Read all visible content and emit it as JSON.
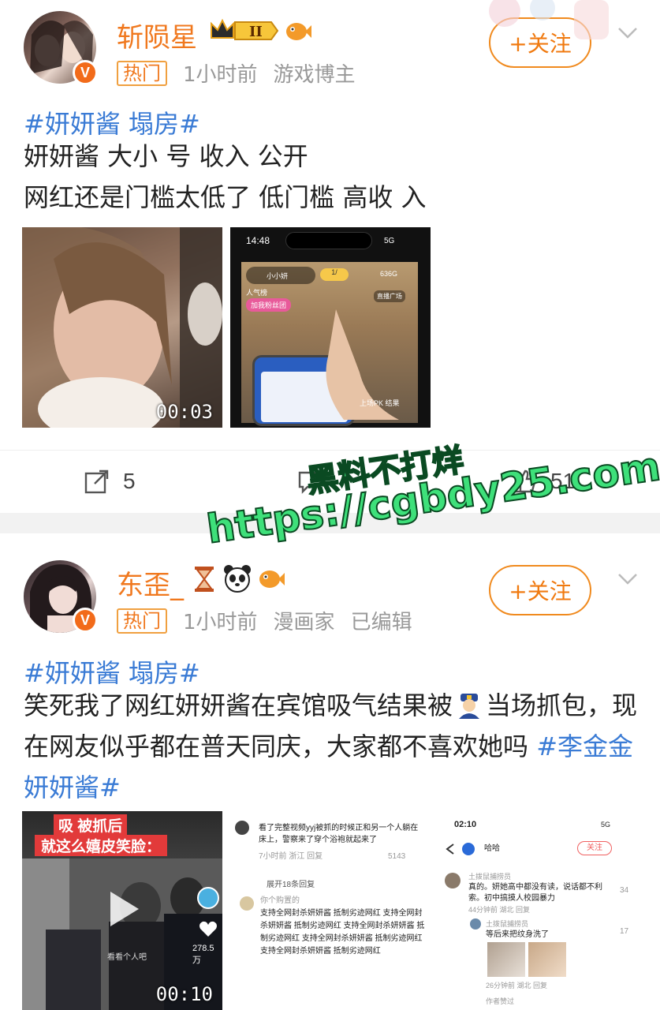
{
  "posts": [
    {
      "username": "斩陨星",
      "level_badge": "II",
      "hot_tag": "热门",
      "time": "1小时前",
      "role": "游戏博主",
      "follow_label": "+关注",
      "topic": "#妍妍酱 塌房#",
      "lines": [
        "妍妍酱 大小 号 收入 公开",
        "网红还是门槛太低了 低门槛 高收 入"
      ],
      "media": [
        {
          "duration": "00:03"
        },
        {
          "status_time": "14:48",
          "status_net": "5G",
          "live_name": "小小妍",
          "live_badge": "1/",
          "live_count": "636G",
          "live_tag": "人气榜",
          "live_btn": "加我粉丝团",
          "plaza": "直播广场",
          "pk": "上场PK 结果"
        }
      ],
      "actions": {
        "repost": "5",
        "comment": "",
        "like": "51"
      }
    },
    {
      "username": "东歪_",
      "hot_tag": "热门",
      "time": "1小时前",
      "role": "漫画家",
      "edited": "已编辑",
      "follow_label": "+关注",
      "topic": "#妍妍酱 塌房#",
      "body_pre": "笑死我了网红妍妍酱在宾馆吸气结果被",
      "body_post": "当场抓包，现在网友似乎都在普天同庆，大家都不喜欢她吗",
      "body_link": "#李金金 妍妍酱#",
      "media": [
        {
          "caption1": "吸 被抓后",
          "caption2": "就这么嬉皮笑脸：",
          "duration": "00:10",
          "likes": "278.5万",
          "bottom_text": "看看个人吧"
        },
        {
          "comment_text": "看了完整视频yyj被抓的时候正和另一个人躺在床上，警察来了穿个浴袍就起来了",
          "meta": "7小时前  浙江  回复",
          "likes": "5143",
          "expand": "展开18条回复",
          "user2": "你个购置的",
          "spam": "支持全网封杀妍妍酱 抵制劣迹网红 支持全网封杀妍妍酱 抵制劣迹网红 支持全网封杀妍妍酱 抵制劣迹网红 支持全网封杀妍妍酱 抵制劣迹网红 支持全网封杀妍妍酱 抵制劣迹网红"
        },
        {
          "time": "02:10",
          "net": "5G",
          "title": "哈哈",
          "follow": "关注",
          "c1_name": "土拨鼠捕捞员",
          "c1_text": "真的。妍她高中都没有读，说话都不利索。初中搞摸人校园暴力",
          "c1_meta": "44分钟前 湖北 回复",
          "c1_likes": "34",
          "c2_name": "土拨鼠捕捞员",
          "c2_text": "等后来把纹身洗了",
          "c2_likes": "17",
          "c2_meta": "26分钟前 湖北 回复",
          "footer": "作者赞过"
        }
      ]
    }
  ],
  "watermark": {
    "line1": "黑料不打烊",
    "line2": "https://cgbdy25.com"
  }
}
